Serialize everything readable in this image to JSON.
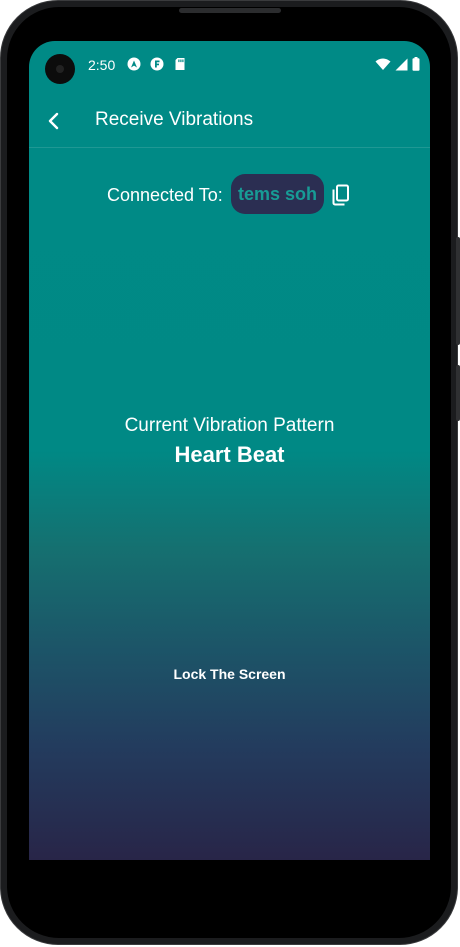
{
  "status_bar": {
    "time": "2:50",
    "left_icons": [
      "android-auto-icon",
      "app-notification-icon",
      "sd-card-icon"
    ],
    "right_icons": [
      "wifi-icon",
      "cellular-signal-icon",
      "battery-icon"
    ]
  },
  "app_bar": {
    "back_icon": "arrow-back-icon",
    "title": "Receive Vibrations"
  },
  "connection": {
    "label": "Connected To:",
    "device_name": "tems soh",
    "copy_icon": "copy-icon"
  },
  "pattern": {
    "caption": "Current Vibration Pattern",
    "name": "Heart Beat"
  },
  "actions": {
    "lock_label": "Lock The Screen"
  },
  "colors": {
    "gradient_top": "#008a86",
    "gradient_bottom": "#282548",
    "chip_background": "#2b2e52",
    "chip_text": "#179c96"
  }
}
